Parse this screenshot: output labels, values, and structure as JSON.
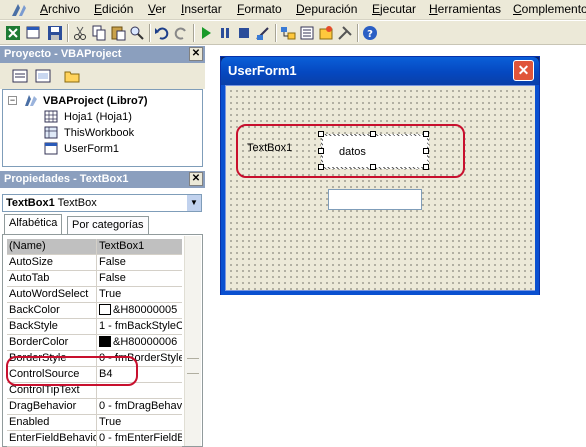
{
  "menu": {
    "items": [
      "Archivo",
      "Edición",
      "Ver",
      "Insertar",
      "Formato",
      "Depuración",
      "Ejecutar",
      "Herramientas",
      "Complemento"
    ]
  },
  "project_panel": {
    "title": "Proyecto - VBAProject",
    "root": "VBAProject (Libro7)",
    "nodes": [
      "Hoja1 (Hoja1)",
      "ThisWorkbook",
      "UserForm1"
    ]
  },
  "properties_panel": {
    "title": "Propiedades - TextBox1",
    "object_name": "TextBox1",
    "object_type": "TextBox",
    "tabs": [
      "Alfabética",
      "Por categorías"
    ],
    "rows": [
      {
        "name": "(Name)",
        "value": "TextBox1"
      },
      {
        "name": "AutoSize",
        "value": "False"
      },
      {
        "name": "AutoTab",
        "value": "False"
      },
      {
        "name": "AutoWordSelect",
        "value": "True"
      },
      {
        "name": "BackColor",
        "value": "&H80000005"
      },
      {
        "name": "BackStyle",
        "value": "1 - fmBackStyleO"
      },
      {
        "name": "BorderColor",
        "value": "&H80000006"
      },
      {
        "name": "BorderStyle",
        "value": "0 - fmBorderStyle"
      },
      {
        "name": "ControlSource",
        "value": "B4"
      },
      {
        "name": "ControlTipText",
        "value": ""
      },
      {
        "name": "DragBehavior",
        "value": "0 - fmDragBehav"
      },
      {
        "name": "Enabled",
        "value": "True"
      },
      {
        "name": "EnterFieldBehavior",
        "value": "0 - fmEnterFieldB"
      }
    ],
    "swatch_colors": {
      "BackColor": "#ffffff",
      "BorderColor": "#000000"
    }
  },
  "designer": {
    "window_title": "UserForm1",
    "label_caption": "TextBox1",
    "textbox1_value": "datos",
    "textbox2_value": ""
  },
  "colors": {
    "annotation": "#c8102e",
    "titlebar": "#0a50d0",
    "panel_title": "#8b9fbe"
  }
}
